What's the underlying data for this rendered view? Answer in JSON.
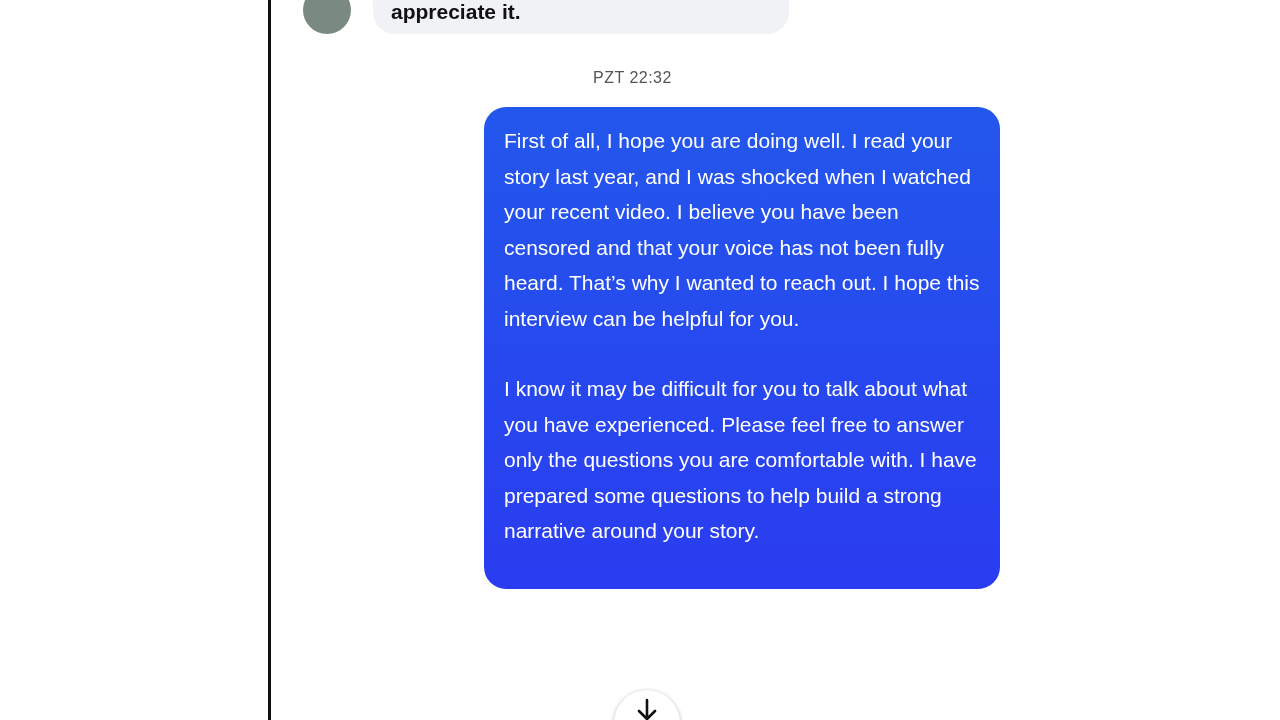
{
  "messages": [
    {
      "kind": "received",
      "text": "appreciate it."
    },
    {
      "kind": "timestamp",
      "text": "PZT 22:32"
    },
    {
      "kind": "sent",
      "paragraphs": [
        "First of all, I hope you are doing well. I read your story last year, and I was shocked when I watched your recent video. I believe you have been censored and that your voice has not been fully heard. That’s why I wanted to reach out. I hope this interview can be helpful for you.",
        "I know it may be difficult for you to talk about what you have experienced. Please feel free to answer only the questions you are comfortable with. I have prepared some questions to help build a strong narrative around your story."
      ]
    }
  ]
}
